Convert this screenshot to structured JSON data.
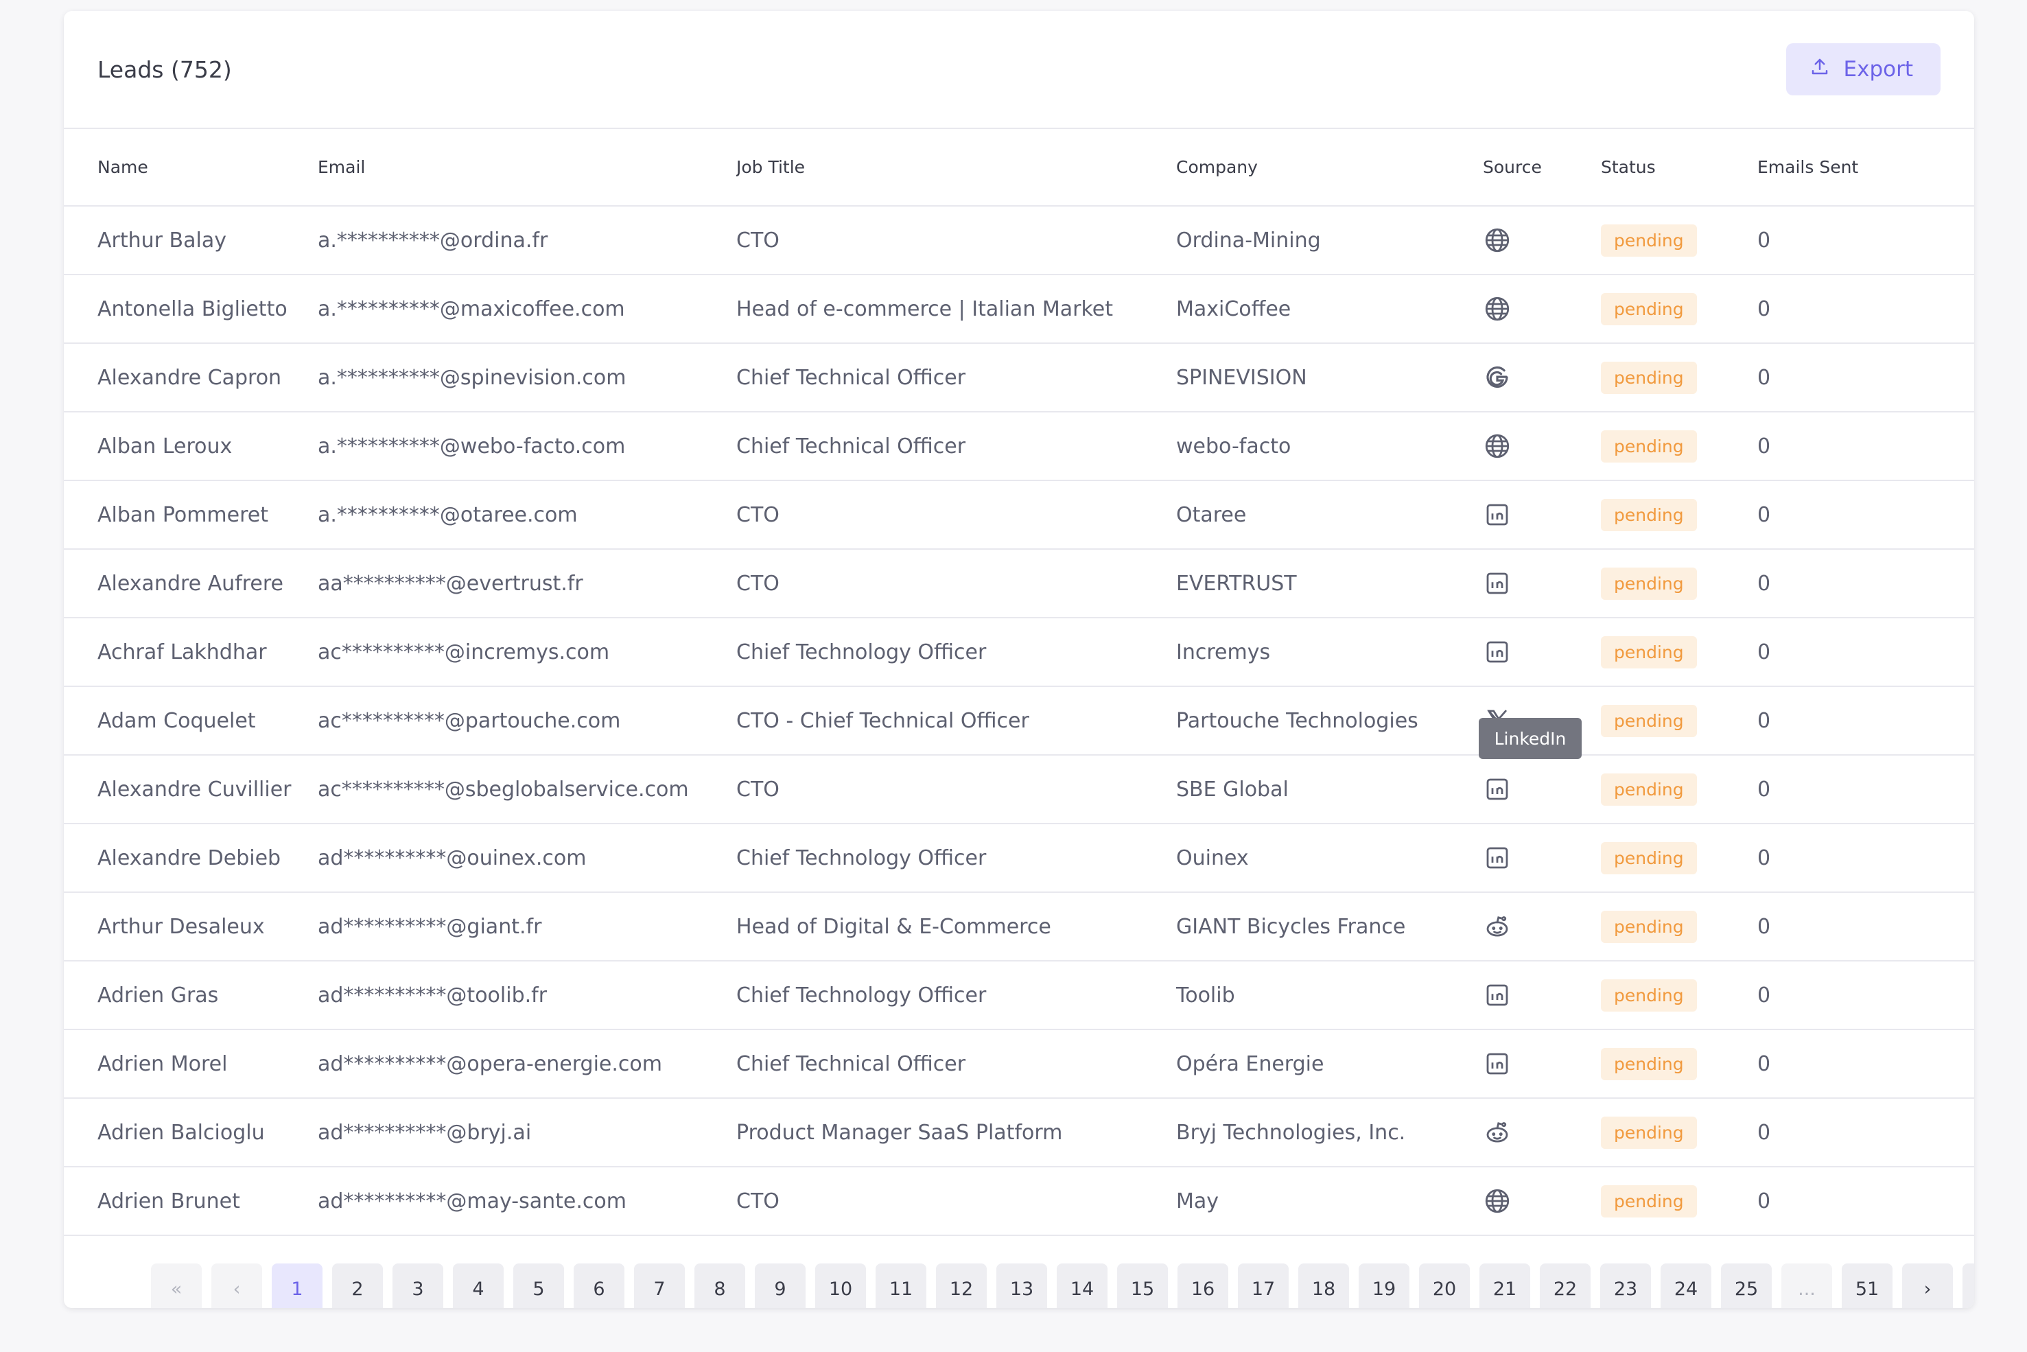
{
  "header": {
    "title": "Leads (752)",
    "export_label": "Export"
  },
  "columns": [
    "Name",
    "Email",
    "Job Title",
    "Company",
    "Source",
    "Status",
    "Emails Sent"
  ],
  "rows": [
    {
      "name": "Arthur Balay",
      "email": "a.**********@ordina.fr",
      "job": "CTO",
      "company": "Ordina-Mining",
      "source": "globe-icon",
      "status": "pending",
      "emails": "0"
    },
    {
      "name": "Antonella Biglietto",
      "email": "a.**********@maxicoffee.com",
      "job": "Head of e-commerce | Italian Market",
      "company": "MaxiCoffee",
      "source": "globe-icon",
      "status": "pending",
      "emails": "0"
    },
    {
      "name": "Alexandre Capron",
      "email": "a.**********@spinevision.com",
      "job": "Chief Technical Officer",
      "company": "SPINEVISION",
      "source": "google-icon",
      "status": "pending",
      "emails": "0"
    },
    {
      "name": "Alban Leroux",
      "email": "a.**********@webo-facto.com",
      "job": "Chief Technical Officer",
      "company": "webo-facto",
      "source": "globe-icon",
      "status": "pending",
      "emails": "0"
    },
    {
      "name": "Alban Pommeret",
      "email": "a.**********@otaree.com",
      "job": "CTO",
      "company": "Otaree",
      "source": "linkedin-icon",
      "status": "pending",
      "emails": "0"
    },
    {
      "name": "Alexandre Aufrere",
      "email": "aa**********@evertrust.fr",
      "job": "CTO",
      "company": "EVERTRUST",
      "source": "linkedin-icon",
      "status": "pending",
      "emails": "0"
    },
    {
      "name": "Achraf Lakhdhar",
      "email": "ac**********@incremys.com",
      "job": "Chief Technology Officer",
      "company": "Incremys",
      "source": "linkedin-icon",
      "status": "pending",
      "emails": "0"
    },
    {
      "name": "Adam Coquelet",
      "email": "ac**********@partouche.com",
      "job": "CTO - Chief Technical Officer",
      "company": "Partouche Technologies",
      "source": "x-icon",
      "status": "pending",
      "emails": "0"
    },
    {
      "name": "Alexandre Cuvillier",
      "email": "ac**********@sbeglobalservice.com",
      "job": "CTO",
      "company": "SBE Global",
      "source": "linkedin-icon",
      "status": "pending",
      "emails": "0"
    },
    {
      "name": "Alexandre Debieb",
      "email": "ad**********@ouinex.com",
      "job": "Chief Technology Officer",
      "company": "Ouinex",
      "source": "linkedin-icon",
      "status": "pending",
      "emails": "0"
    },
    {
      "name": "Arthur Desaleux",
      "email": "ad**********@giant.fr",
      "job": "Head of Digital & E-Commerce",
      "company": "GIANT Bicycles France",
      "source": "reddit-icon",
      "status": "pending",
      "emails": "0"
    },
    {
      "name": "Adrien Gras",
      "email": "ad**********@toolib.fr",
      "job": "Chief Technology Officer",
      "company": "Toolib",
      "source": "linkedin-icon",
      "status": "pending",
      "emails": "0"
    },
    {
      "name": "Adrien Morel",
      "email": "ad**********@opera-energie.com",
      "job": "Chief Technical Officer",
      "company": "Opéra Energie",
      "source": "linkedin-icon",
      "status": "pending",
      "emails": "0"
    },
    {
      "name": "Adrien Balcioglu",
      "email": "ad**********@bryj.ai",
      "job": "Product Manager SaaS Platform",
      "company": "Bryj Technologies, Inc.",
      "source": "reddit-icon",
      "status": "pending",
      "emails": "0"
    },
    {
      "name": "Adrien Brunet",
      "email": "ad**********@may-sante.com",
      "job": "CTO",
      "company": "May",
      "source": "globe-icon",
      "status": "pending",
      "emails": "0"
    }
  ],
  "tooltip": {
    "text": "LinkedIn"
  },
  "pagination": {
    "first": "«",
    "prev": "‹",
    "pages": [
      "1",
      "2",
      "3",
      "4",
      "5",
      "6",
      "7",
      "8",
      "9",
      "10",
      "11",
      "12",
      "13",
      "14",
      "15",
      "16",
      "17",
      "18",
      "19",
      "20",
      "21",
      "22",
      "23",
      "24",
      "25"
    ],
    "ellipsis": "...",
    "last_page": "51",
    "next": "›",
    "last": "»",
    "current": "1"
  },
  "colors": {
    "accent": "#6c63e8",
    "accent_bg": "#e8e7fd",
    "pending_text": "#f19a3e",
    "pending_bg": "#fdf0e0"
  }
}
